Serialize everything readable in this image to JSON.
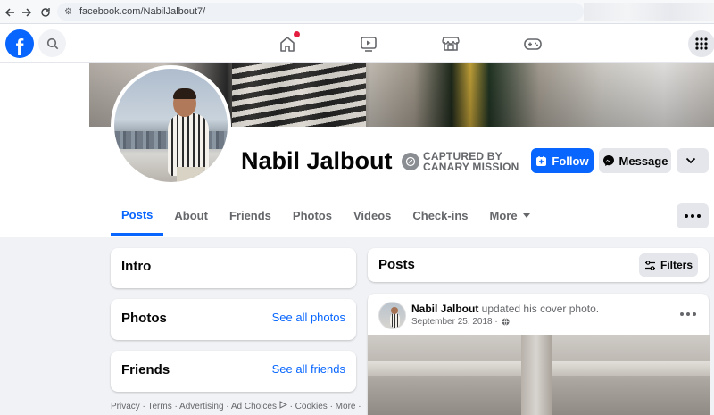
{
  "browser": {
    "url": "facebook.com/NabilJalbout7/"
  },
  "profile": {
    "name": "Nabil Jalbout",
    "stamp_line1": "CAPTURED BY",
    "stamp_line2": "CANARY MISSION",
    "follow_label": "Follow",
    "message_label": "Message"
  },
  "tabs": [
    {
      "label": "Posts",
      "active": true
    },
    {
      "label": "About"
    },
    {
      "label": "Friends"
    },
    {
      "label": "Photos"
    },
    {
      "label": "Videos"
    },
    {
      "label": "Check-ins"
    },
    {
      "label": "More"
    }
  ],
  "sidebar": {
    "intro_title": "Intro",
    "photos_title": "Photos",
    "photos_link": "See all photos",
    "friends_title": "Friends",
    "friends_link": "See all friends",
    "footer": "Privacy · Terms · Advertising · Ad Choices",
    "footer_tail": "· Cookies · More ·"
  },
  "posts": {
    "title": "Posts",
    "filters_label": "Filters",
    "post_author": "Nabil Jalbout",
    "post_action": " updated his cover photo.",
    "post_date": "September 25, 2018 ·"
  },
  "colors": {
    "brand": "#0866ff",
    "notification": "#e41e3f"
  },
  "icons": [
    "back-arrow-icon",
    "forward-arrow-icon",
    "reload-icon",
    "site-settings-icon",
    "facebook-logo",
    "search-icon",
    "home-icon",
    "video-icon",
    "marketplace-icon",
    "gaming-icon",
    "menu-grid-icon",
    "capture-badge-icon",
    "follow-icon",
    "messenger-icon",
    "chevron-down-icon",
    "more-dots-icon",
    "filters-icon",
    "globe-icon",
    "adchoices-icon"
  ]
}
